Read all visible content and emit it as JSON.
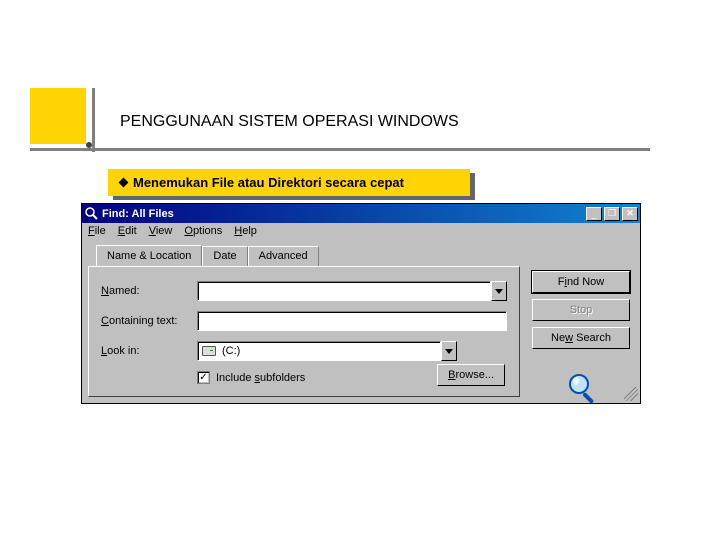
{
  "title": "PENGGUNAAN SISTEM OPERASI WINDOWS",
  "callout": "Menemukan File atau Direktori secara cepat",
  "win": {
    "caption": "Find: All Files",
    "sysbuttons": {
      "min": "_",
      "max": "❐",
      "close": "✕"
    },
    "menus": [
      "File",
      "Edit",
      "View",
      "Options",
      "Help"
    ],
    "tabs": {
      "active": "Name & Location",
      "others": [
        "Date",
        "Advanced"
      ]
    },
    "labels": {
      "named": "Named:",
      "containing": "Containing text:",
      "lookin": "Look in:",
      "include": "Include subfolders",
      "browse": "Browse..."
    },
    "values": {
      "named": "",
      "containing": "",
      "lookin": "(C:)",
      "include_checked": "✓"
    },
    "buttons": {
      "find": "Find Now",
      "stop": "Stop",
      "newsearch": "New Search"
    }
  }
}
